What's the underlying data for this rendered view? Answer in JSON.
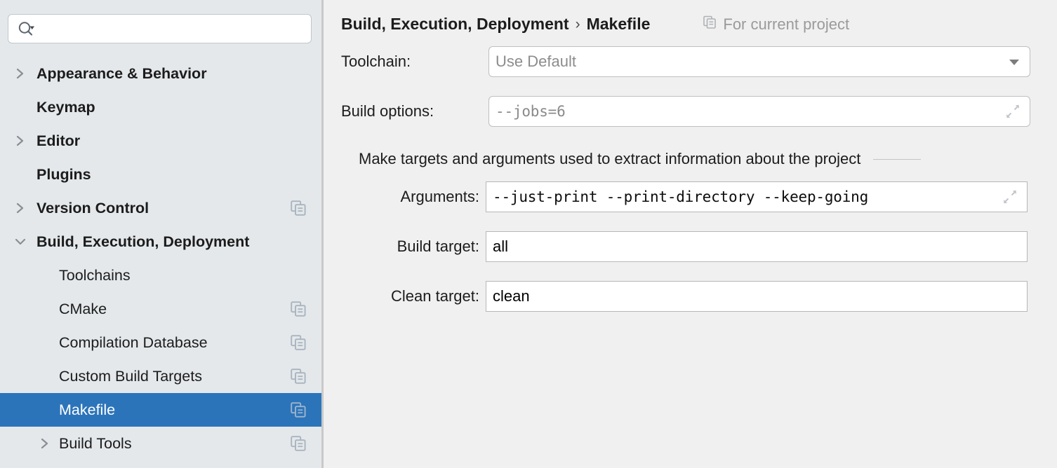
{
  "sidebar": {
    "search": {
      "value": "",
      "placeholder": "",
      "icon": "search-icon",
      "dropdown_icon": "chevron-down-icon"
    },
    "items": [
      {
        "label": "Appearance & Behavior",
        "level": 0,
        "expandable": true,
        "expanded": false,
        "selected": false,
        "copy_icon": false
      },
      {
        "label": "Keymap",
        "level": 0,
        "expandable": false,
        "expanded": false,
        "selected": false,
        "copy_icon": false
      },
      {
        "label": "Editor",
        "level": 0,
        "expandable": true,
        "expanded": false,
        "selected": false,
        "copy_icon": false
      },
      {
        "label": "Plugins",
        "level": 0,
        "expandable": false,
        "expanded": false,
        "selected": false,
        "copy_icon": false
      },
      {
        "label": "Version Control",
        "level": 0,
        "expandable": true,
        "expanded": false,
        "selected": false,
        "copy_icon": true
      },
      {
        "label": "Build, Execution, Deployment",
        "level": 0,
        "expandable": true,
        "expanded": true,
        "selected": false,
        "copy_icon": false
      },
      {
        "label": "Toolchains",
        "level": 1,
        "expandable": false,
        "expanded": false,
        "selected": false,
        "copy_icon": false
      },
      {
        "label": "CMake",
        "level": 1,
        "expandable": false,
        "expanded": false,
        "selected": false,
        "copy_icon": true
      },
      {
        "label": "Compilation Database",
        "level": 1,
        "expandable": false,
        "expanded": false,
        "selected": false,
        "copy_icon": true
      },
      {
        "label": "Custom Build Targets",
        "level": 1,
        "expandable": false,
        "expanded": false,
        "selected": false,
        "copy_icon": true
      },
      {
        "label": "Makefile",
        "level": 1,
        "expandable": false,
        "expanded": false,
        "selected": true,
        "copy_icon": true
      },
      {
        "label": "Build Tools",
        "level": 1,
        "expandable": true,
        "expanded": false,
        "selected": false,
        "copy_icon": true
      }
    ]
  },
  "header": {
    "breadcrumb": [
      "Build, Execution, Deployment",
      "Makefile"
    ],
    "separator": "›",
    "scope_label": "For current project",
    "scope_icon": "project-scope-icon"
  },
  "form": {
    "toolchain": {
      "label": "Toolchain:",
      "value": "Use Default",
      "is_placeholder": true,
      "dropdown_icon": "chevron-down-icon"
    },
    "build_options": {
      "label": "Build options:",
      "value": "--jobs=6",
      "is_placeholder": true,
      "expand_icon": "expand-icon"
    },
    "section_title": "Make targets and arguments used to extract information about the project",
    "arguments": {
      "label": "Arguments:",
      "value": "--just-print --print-directory --keep-going",
      "is_placeholder": false,
      "expand_icon": "expand-icon"
    },
    "build_target": {
      "label": "Build target:",
      "value": "all",
      "is_placeholder": false
    },
    "clean_target": {
      "label": "Clean target:",
      "value": "clean",
      "is_placeholder": false
    }
  },
  "colors": {
    "selection_blue": "#2c74ba",
    "sidebar_bg": "#e4e8eb",
    "panel_bg": "#f0f0f0",
    "placeholder_gray": "#8a8a8a",
    "icon_gray": "#a9b4bf"
  }
}
